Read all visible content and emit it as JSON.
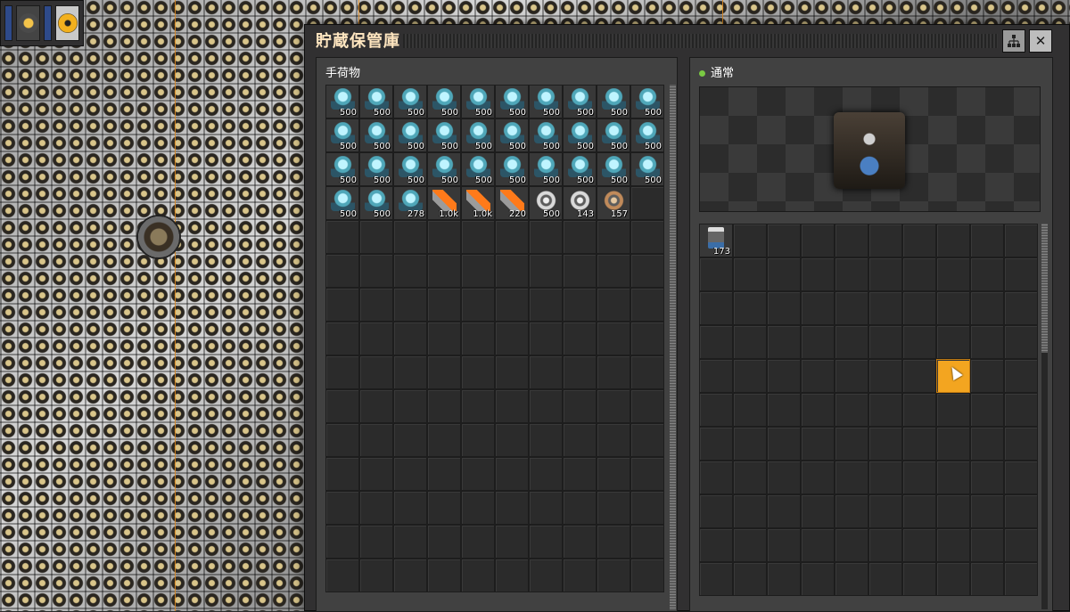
{
  "window": {
    "title": "貯蔵保管庫",
    "tree_icon": "tech-tree-icon",
    "close_label": "✕"
  },
  "inventory": {
    "header": "手荷物",
    "rows": 15,
    "cols": 10,
    "items": [
      {
        "icon": "robot-frame-icon",
        "count": "500"
      },
      {
        "icon": "robot-frame-icon",
        "count": "500"
      },
      {
        "icon": "robot-frame-icon",
        "count": "500"
      },
      {
        "icon": "robot-frame-icon",
        "count": "500"
      },
      {
        "icon": "robot-frame-icon",
        "count": "500"
      },
      {
        "icon": "robot-frame-icon",
        "count": "500"
      },
      {
        "icon": "robot-frame-icon",
        "count": "500"
      },
      {
        "icon": "robot-frame-icon",
        "count": "500"
      },
      {
        "icon": "robot-frame-icon",
        "count": "500"
      },
      {
        "icon": "robot-frame-icon",
        "count": "500"
      },
      {
        "icon": "robot-frame-icon",
        "count": "500"
      },
      {
        "icon": "robot-frame-icon",
        "count": "500"
      },
      {
        "icon": "robot-frame-icon",
        "count": "500"
      },
      {
        "icon": "robot-frame-icon",
        "count": "500"
      },
      {
        "icon": "robot-frame-icon",
        "count": "500"
      },
      {
        "icon": "robot-frame-icon",
        "count": "500"
      },
      {
        "icon": "robot-frame-icon",
        "count": "500"
      },
      {
        "icon": "robot-frame-icon",
        "count": "500"
      },
      {
        "icon": "robot-frame-icon",
        "count": "500"
      },
      {
        "icon": "robot-frame-icon",
        "count": "500"
      },
      {
        "icon": "robot-frame-icon",
        "count": "500"
      },
      {
        "icon": "robot-frame-icon",
        "count": "500"
      },
      {
        "icon": "robot-frame-icon",
        "count": "500"
      },
      {
        "icon": "robot-frame-icon",
        "count": "500"
      },
      {
        "icon": "robot-frame-icon",
        "count": "500"
      },
      {
        "icon": "robot-frame-icon",
        "count": "500"
      },
      {
        "icon": "robot-frame-icon",
        "count": "500"
      },
      {
        "icon": "robot-frame-icon",
        "count": "500"
      },
      {
        "icon": "robot-frame-icon",
        "count": "500"
      },
      {
        "icon": "robot-frame-icon",
        "count": "500"
      },
      {
        "icon": "robot-frame-icon",
        "count": "500"
      },
      {
        "icon": "robot-frame-icon",
        "count": "500"
      },
      {
        "icon": "robot-frame-icon",
        "count": "278"
      },
      {
        "icon": "battery-icon",
        "count": "1.0k"
      },
      {
        "icon": "battery-icon",
        "count": "1.0k"
      },
      {
        "icon": "battery-icon",
        "count": "220"
      },
      {
        "icon": "gear-icon",
        "count": "500"
      },
      {
        "icon": "gear-icon",
        "count": "143"
      },
      {
        "icon": "brown-gear-icon",
        "count": "157"
      }
    ]
  },
  "storage": {
    "status": "通常",
    "status_color": "#7ac943",
    "rows": 11,
    "cols": 10,
    "items": [
      {
        "icon": "roboport-icon",
        "count": "173"
      }
    ],
    "hover_slot": 47
  },
  "colors": {
    "title": "#ffe6c0",
    "hover_slot": "#f3a520",
    "panel": "#414141"
  }
}
